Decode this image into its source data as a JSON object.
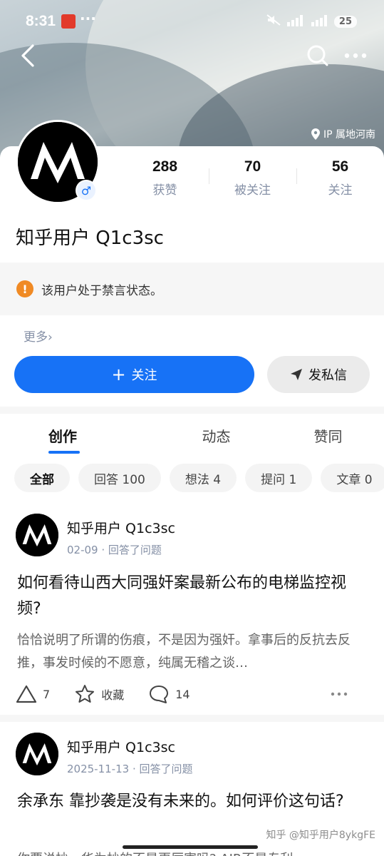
{
  "status_bar": {
    "time": "8:31",
    "battery": "25",
    "signal1": "5G",
    "signal2": "4G"
  },
  "header": {
    "ip_location": "IP 属地河南"
  },
  "profile": {
    "stats": [
      {
        "value": "288",
        "label": "获赞"
      },
      {
        "value": "70",
        "label": "被关注"
      },
      {
        "value": "56",
        "label": "关注"
      }
    ],
    "name": "知乎用户 Q1c3sc",
    "gender_symbol": "♂",
    "ban_notice": "该用户处于禁言状态。",
    "more_label": "更多›"
  },
  "actions": {
    "follow_label": "关注",
    "follow_plus": "+",
    "message_label": "发私信"
  },
  "tabs": [
    {
      "label": "创作",
      "active": true
    },
    {
      "label": "动态",
      "active": false
    },
    {
      "label": "赞同",
      "active": false
    }
  ],
  "filters": [
    {
      "label": "全部",
      "active": true
    },
    {
      "label": "回答 100",
      "active": false
    },
    {
      "label": "想法 4",
      "active": false
    },
    {
      "label": "提问 1",
      "active": false
    },
    {
      "label": "文章 0",
      "active": false
    }
  ],
  "feed": [
    {
      "author": "知乎用户 Q1c3sc",
      "meta": "02-09 · 回答了问题",
      "title": "如何看待山西大同强奸案最新公布的电梯监控视频?",
      "excerpt": "恰恰说明了所谓的伤痕，不是因为强奸。拿事后的反抗去反推，事发时候的不愿意，纯属无稽之谈…",
      "upvotes": "7",
      "collect_label": "收藏",
      "comments": "14"
    },
    {
      "author": "知乎用户 Q1c3sc",
      "meta": "2025-11-13 · 回答了问题",
      "title": "余承东 靠抄袭是没有未来的。如何评价这句话?",
      "excerpt": "你要说抄，华为抄的不是更厉害吗? AIR不是专利"
    }
  ],
  "watermark": "知乎 @知乎用户8ykgFE"
}
